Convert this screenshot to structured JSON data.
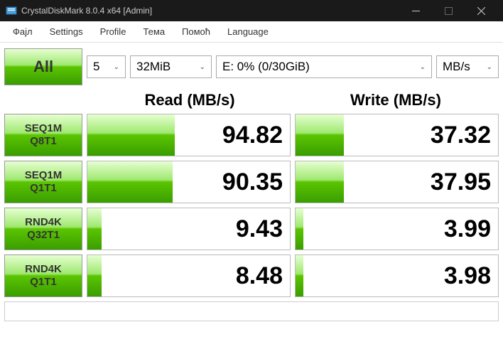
{
  "titlebar": {
    "title": "CrystalDiskMark 8.0.4 x64 [Admin]"
  },
  "menubar": {
    "items": [
      "Фајл",
      "Settings",
      "Profile",
      "Тема",
      "Помоћ",
      "Language"
    ]
  },
  "toolbar": {
    "all_label": "All",
    "runs": "5",
    "size": "32MiB",
    "drive": "E: 0% (0/30GiB)",
    "unit": "MB/s"
  },
  "headers": {
    "read": "Read (MB/s)",
    "write": "Write (MB/s)"
  },
  "rows": [
    {
      "label1": "SEQ1M",
      "label2": "Q8T1",
      "read": "94.82",
      "write": "37.32",
      "read_pct": 43,
      "write_pct": 24
    },
    {
      "label1": "SEQ1M",
      "label2": "Q1T1",
      "read": "90.35",
      "write": "37.95",
      "read_pct": 42,
      "write_pct": 24
    },
    {
      "label1": "RND4K",
      "label2": "Q32T1",
      "read": "9.43",
      "write": "3.99",
      "read_pct": 7,
      "write_pct": 4
    },
    {
      "label1": "RND4K",
      "label2": "Q1T1",
      "read": "8.48",
      "write": "3.98",
      "read_pct": 7,
      "write_pct": 4
    }
  ]
}
